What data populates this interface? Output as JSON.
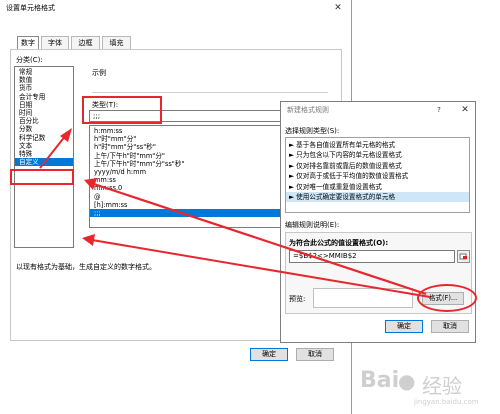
{
  "format_dialog": {
    "title": "设置单元格格式",
    "close_glyph": "✕",
    "tabs": [
      "数字",
      "字体",
      "边框",
      "填充"
    ],
    "category_label": "分类(C):",
    "categories": [
      "常规",
      "数值",
      "货币",
      "会计专用",
      "日期",
      "时间",
      "百分比",
      "分数",
      "科学记数",
      "文本",
      "特殊",
      "自定义"
    ],
    "selected_category": "自定义",
    "sample_label": "示例",
    "type_label": "类型(T):",
    "type_value": ";;;",
    "type_list": [
      "h:mm:ss",
      "h\"时\"mm\"分\"",
      "h\"时\"mm\"分\"ss\"秒\"",
      "上午/下午h\"时\"mm\"分\"",
      "上午/下午h\"时\"mm\"分\"ss\"秒\"",
      "yyyy/m/d h:mm",
      "mm:ss",
      "mm:ss.0",
      "@",
      "[h]:mm:ss",
      ";;;"
    ],
    "selected_type": ";;;",
    "description": "以现有格式为基础，生成自定义的数字格式。",
    "ok_label": "确定",
    "cancel_label": "取消"
  },
  "rule_dialog": {
    "title": "新建格式规则",
    "help_glyph": "?",
    "close_glyph": "✕",
    "select_type_label": "选择规则类型(S):",
    "rule_types": [
      "► 基于各自值设置所有单元格的格式",
      "► 只为包含以下内容的单元格设置格式",
      "► 仅对排名靠前或靠后的数值设置格式",
      "► 仅对高于或低于平均值的数值设置格式",
      "► 仅对唯一值或重复值设置格式",
      "► 使用公式确定要设置格式的单元格"
    ],
    "selected_rule_type": "► 使用公式确定要设置格式的单元格",
    "edit_desc_label": "编辑规则说明(E):",
    "formula_label": "为符合此公式的值设置格式(O):",
    "formula_value": "=$B$2<>MMIB$2",
    "preview_label": "预览:",
    "format_button": "格式(F)...",
    "ok_label": "确定",
    "cancel_label": "取消"
  },
  "watermark": {
    "brand": "Bai",
    "suffix": "经验",
    "url": "jingyan.baidu.com"
  },
  "colors": {
    "annotation_red": "#e8262e",
    "selection_blue": "#0078d7",
    "rule_selection": "#cfe6f8"
  }
}
